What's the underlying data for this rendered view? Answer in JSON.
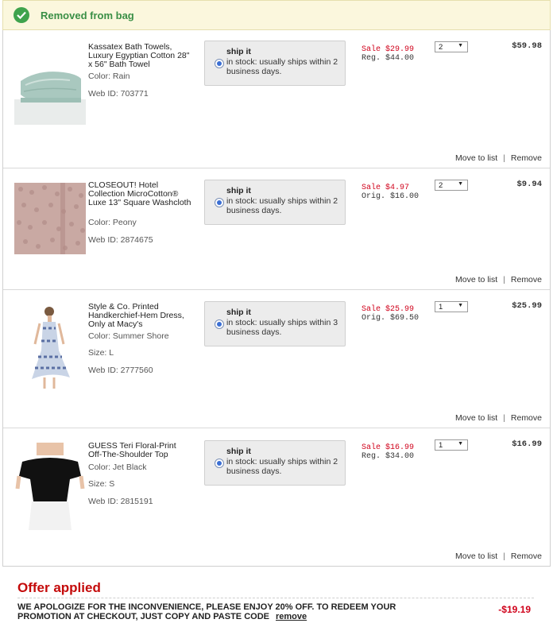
{
  "banner": {
    "message": "Removed from bag",
    "icon": "check-circle-icon"
  },
  "items": [
    {
      "name": "Kassatex Bath Towels, Luxury Egyptian Cotton 28\" x 56\" Bath Towel",
      "color_label": "Color: Rain",
      "size_label": "",
      "web_id": "Web ID: 703771",
      "ship_title": "ship it",
      "ship_desc": "in stock: usually ships within 2 business days.",
      "sale": "Sale $29.99",
      "reg": "Reg. $44.00",
      "qty": "2",
      "total": "$59.98",
      "move": "Move to list",
      "remove": "Remove"
    },
    {
      "name": "CLOSEOUT! Hotel Collection MicroCotton® Luxe 13\" Square Washcloth",
      "color_label": "Color: Peony",
      "size_label": "",
      "web_id": "Web ID: 2874675",
      "ship_title": "ship it",
      "ship_desc": "in stock: usually ships within 2 business days.",
      "sale": "Sale $4.97",
      "reg": "Orig. $16.00",
      "qty": "2",
      "total": "$9.94",
      "move": "Move to list",
      "remove": "Remove"
    },
    {
      "name": "Style & Co. Printed Handkerchief-Hem Dress, Only at Macy's",
      "color_label": "Color: Summer Shore",
      "size_label": "Size: L",
      "web_id": "Web ID: 2777560",
      "ship_title": "ship it",
      "ship_desc": "in stock: usually ships within 3 business days.",
      "sale": "Sale $25.99",
      "reg": "Orig. $69.50",
      "qty": "1",
      "total": "$25.99",
      "move": "Move to list",
      "remove": "Remove"
    },
    {
      "name": "GUESS Teri Floral-Print Off-The-Shoulder Top",
      "color_label": "Color: Jet Black",
      "size_label": "Size: S",
      "web_id": "Web ID: 2815191",
      "ship_title": "ship it",
      "ship_desc": "in stock: usually ships within 2 business days.",
      "sale": "Sale $16.99",
      "reg": "Reg. $34.00",
      "qty": "1",
      "total": "$16.99",
      "move": "Move to list",
      "remove": "Remove"
    }
  ],
  "separator": "|",
  "offer": {
    "title": "Offer applied",
    "text": "WE APOLOGIZE FOR THE INCONVENIENCE, PLEASE ENJOY 20% OFF. TO REDEEM YOUR PROMOTION AT CHECKOUT, JUST COPY AND PASTE CODE",
    "remove": "remove",
    "discount": "-$19.19"
  },
  "colors": {
    "sale_red": "#d0021b",
    "offer_red": "#c40a0a",
    "banner_green": "#3a8f46",
    "banner_bg": "#fbf7dd"
  }
}
